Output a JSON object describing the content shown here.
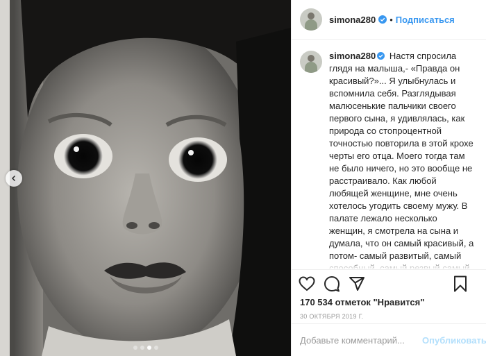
{
  "post": {
    "photo_alt_icon": "baby-photo",
    "carousel": {
      "total": 4,
      "active_index": 2
    }
  },
  "header": {
    "username": "simona280",
    "separator": "•",
    "follow_label": "Подписаться"
  },
  "caption": {
    "username": "simona280",
    "text": "Настя спросила глядя на малыша,- «Правда он красивый?»... Я улыбнулась и вспомнила себя. Разглядывая малюсенькие пальчики своего первого сына, я удивлялась, как природа со стопроцентной точностью повторила в этой крохе черты его отца. Моего тогда там не было ничего, но это вообще не расстраивало. Как любой любящей женщине, мне очень хотелось угодить своему мужу. В палате лежало несколько женщин, я смотрела на сына и думала, что он самый красивый, а потом- самый развитый, самый способный, самый резвый,самый умный... Не помню, когда я перестала так думать, но"
  },
  "actions": {
    "like_icon": "heart-icon",
    "comment_icon": "comment-icon",
    "share_icon": "share-icon",
    "save_icon": "bookmark-icon"
  },
  "likes_text": "170 534 отметок \"Нравится\"",
  "date_text": "30 ОКТЯБРЯ 2019 Г.",
  "comment_box": {
    "placeholder": "Добавьте комментарий...",
    "post_label": "Опубликовать"
  },
  "colors": {
    "accent": "#3897f0",
    "post_disabled": "#b2dffc",
    "muted": "#999999"
  }
}
